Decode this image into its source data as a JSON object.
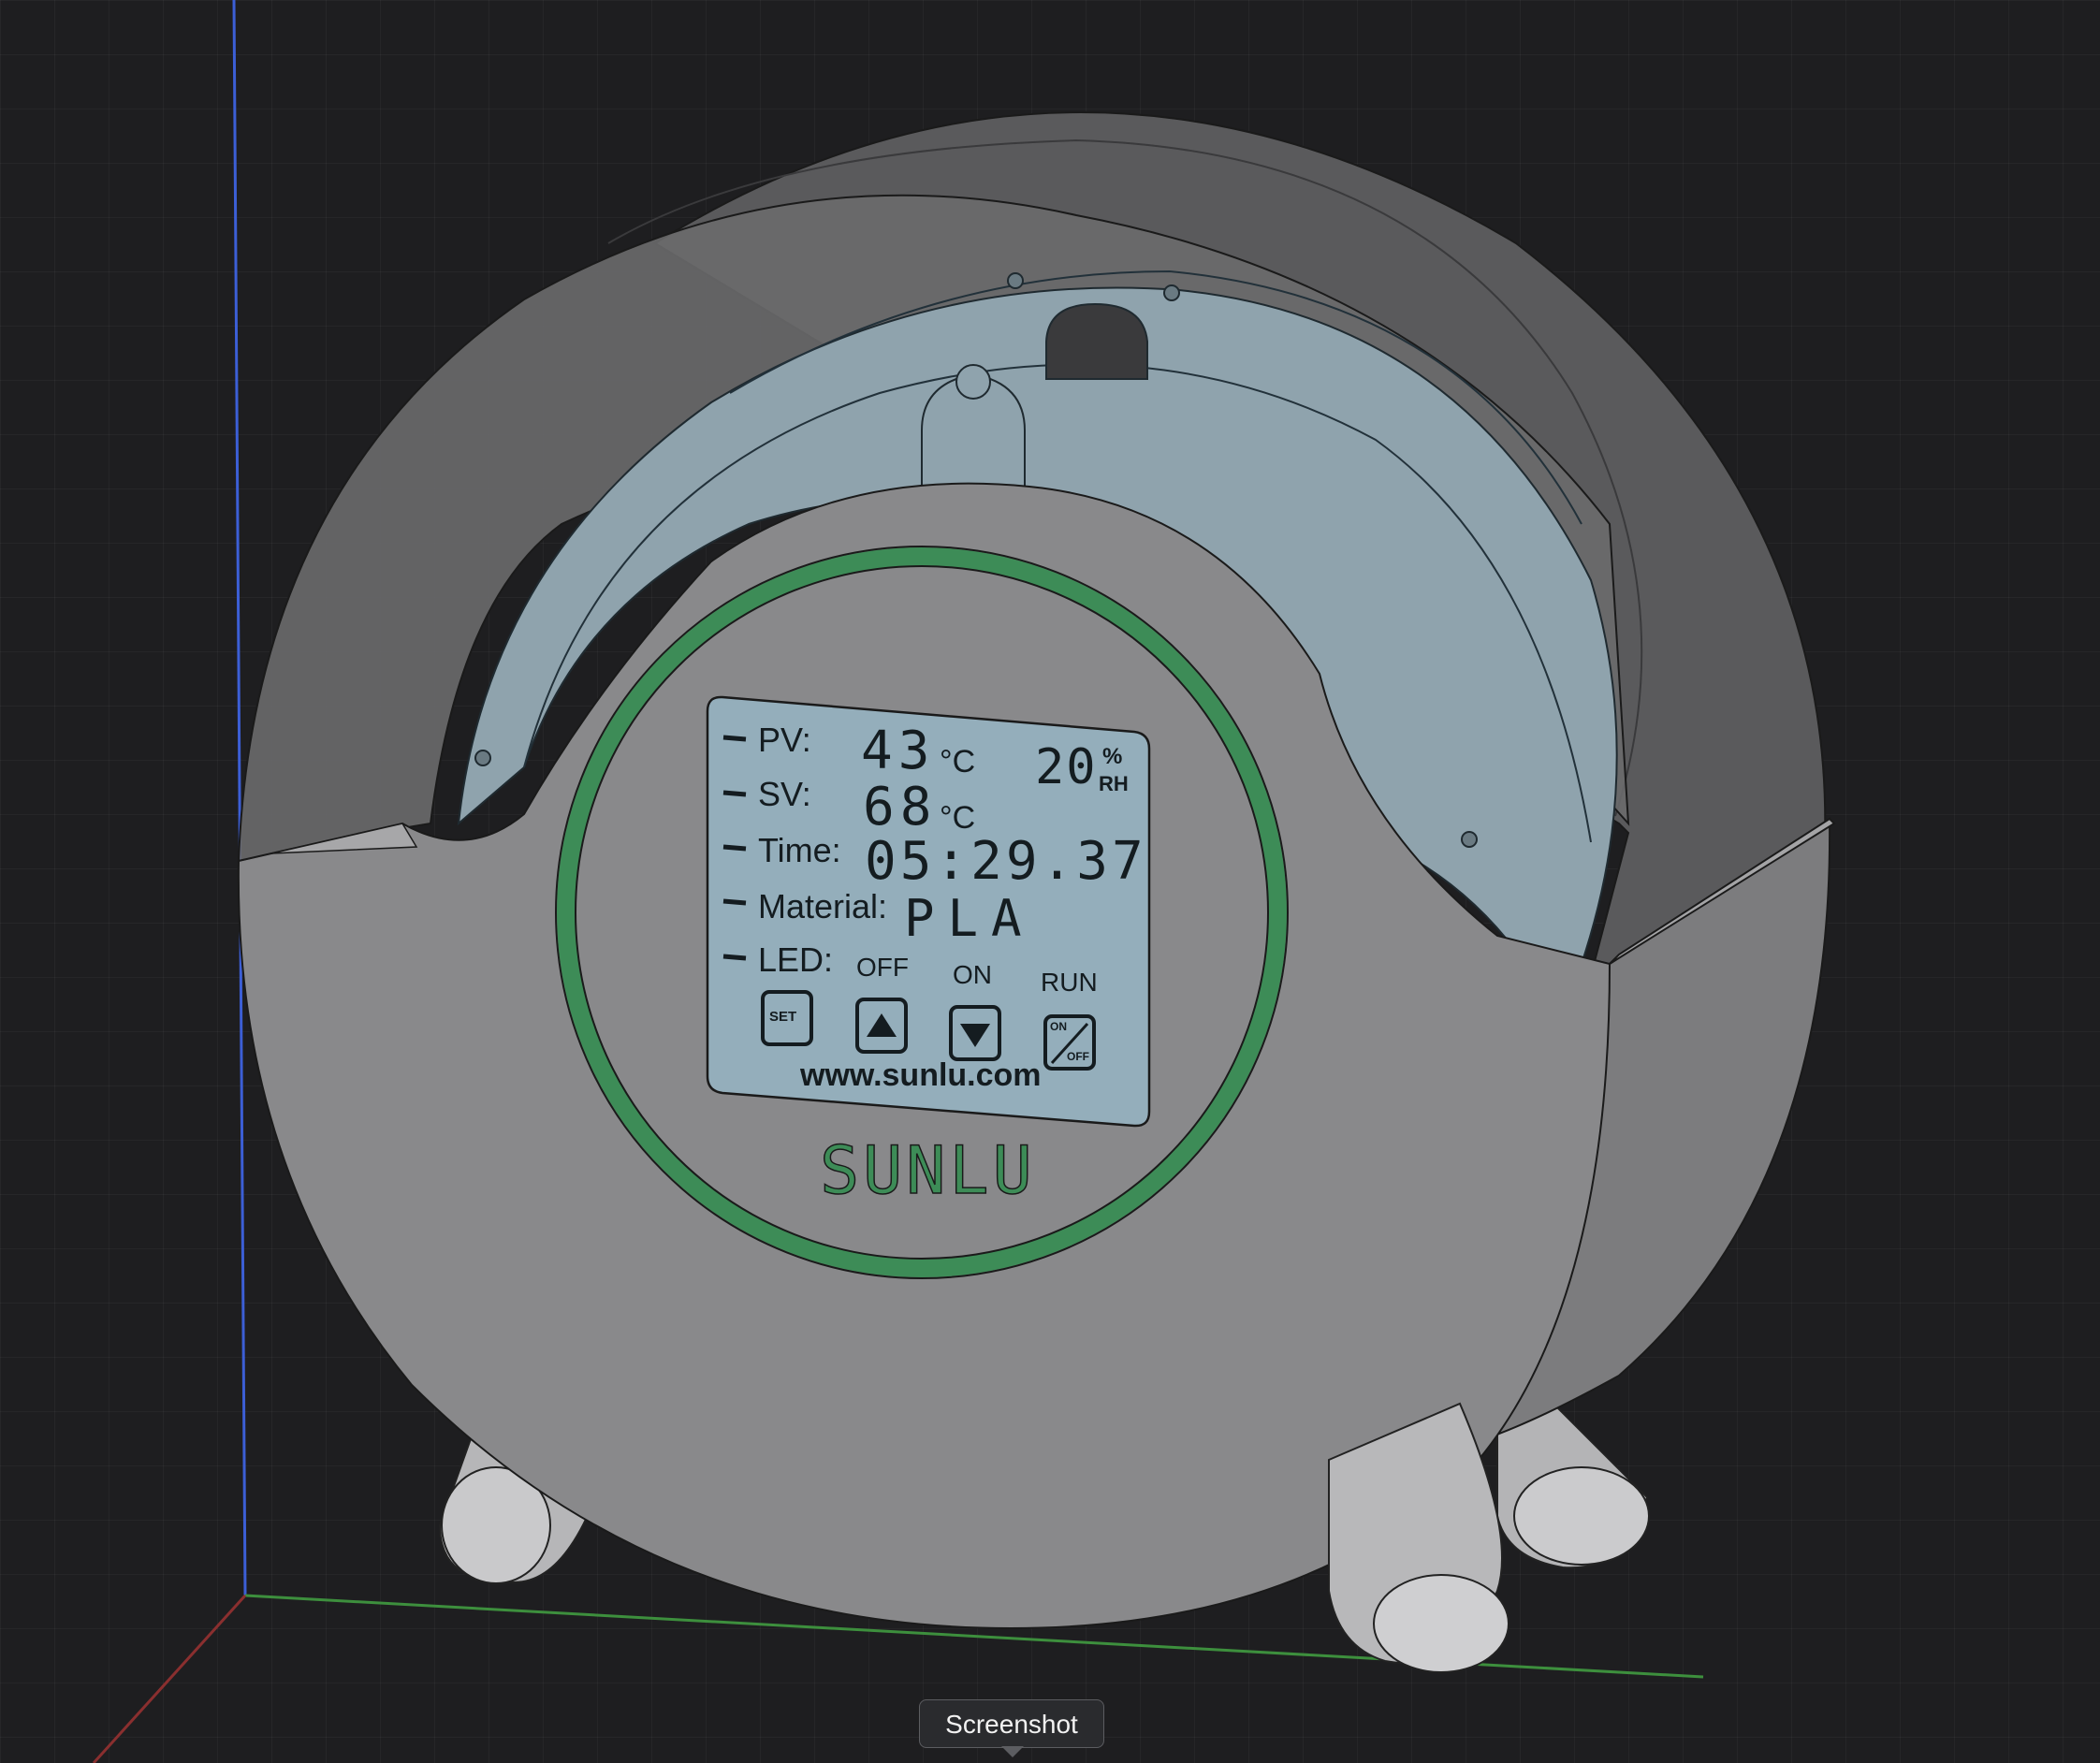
{
  "lcd": {
    "pv_label": "PV:",
    "pv_value": "43",
    "pv_unit": "°C",
    "humidity_value": "20",
    "humidity_unit_top": "%",
    "humidity_unit_bottom": "RH",
    "sv_label": "SV:",
    "sv_value": "68",
    "sv_unit": "°C",
    "time_label": "Time:",
    "time_value": "05:29.37",
    "material_label": "Material:",
    "material_value": "PLA",
    "led_label": "LED:",
    "led_off": "OFF",
    "led_on": "ON",
    "led_run": "RUN",
    "btn_set": "SET",
    "btn_onoff_top": "ON",
    "btn_onoff_bottom": "OFF",
    "website": "www.sunlu.com"
  },
  "brand": {
    "logo_text": "SUNLU"
  },
  "tooltip": {
    "label": "Screenshot"
  },
  "colors": {
    "background": "#1e1e20",
    "housing": "#8a8a8c",
    "lcd": "#94aebb",
    "ring": "#3d8c57",
    "logo": "#3d8c57"
  }
}
